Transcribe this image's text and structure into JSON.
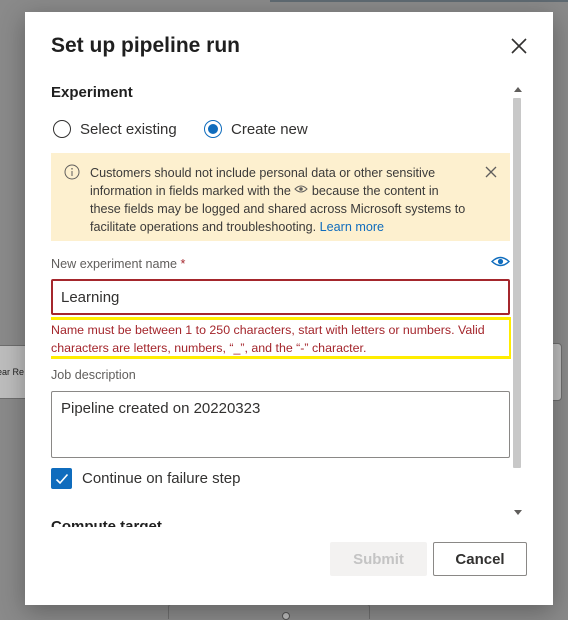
{
  "background": {
    "left_box_text": "ear Re"
  },
  "dialog": {
    "title": "Set up pipeline run",
    "experiment": {
      "section_label": "Experiment",
      "options": [
        {
          "label": "Select existing",
          "selected": false
        },
        {
          "label": "Create new",
          "selected": true
        }
      ]
    },
    "info_banner": {
      "icon": "info-icon",
      "text_before_icon": "Customers should not include personal data or other sensitive information in fields marked with the ",
      "text_after_icon": " because the content in these fields may be logged and shared across Microsoft systems to facilitate operations and troubleshooting.",
      "link_text": "Learn more",
      "inline_icon": "eye-icon",
      "background_color": "#fdf0cf"
    },
    "experiment_name": {
      "label": "New experiment name",
      "required_marker": "*",
      "value": "Learning",
      "privacy_icon": "eye-icon",
      "error": "Name must be between 1 to 250 characters, start with letters or numbers. Valid characters are letters, numbers, “_”, and the “-” character.",
      "error_color": "#a4262c",
      "highlight_color": "#ffed00"
    },
    "job_description": {
      "label": "Job description",
      "value": "Pipeline created on 20220323"
    },
    "continue_on_failure": {
      "label": "Continue on failure step",
      "checked": true
    },
    "next_section_label": "Compute target",
    "buttons": {
      "submit": "Submit",
      "cancel": "Cancel"
    },
    "accent_color": "#0f6cbd"
  }
}
